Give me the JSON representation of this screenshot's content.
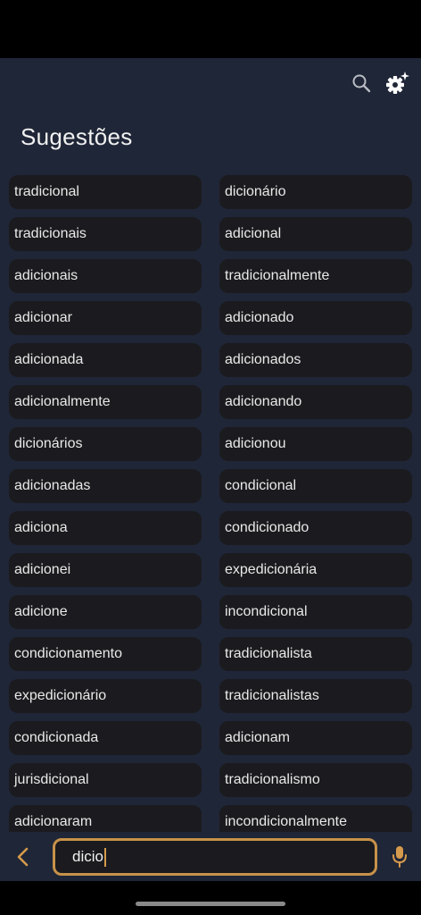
{
  "header": {
    "title": "Sugestões",
    "search_icon": "search-icon",
    "settings_icon": "gear-sparkle-icon"
  },
  "suggestions": [
    "tradicional",
    "dicionário",
    "tradicionais",
    "adicional",
    "adicionais",
    "tradicionalmente",
    "adicionar",
    "adicionado",
    "adicionada",
    "adicionados",
    "adicionalmente",
    "adicionando",
    "dicionários",
    "adicionou",
    "adicionadas",
    "condicional",
    "adiciona",
    "condicionado",
    "adicionei",
    "expedicionária",
    "adicione",
    "incondicional",
    "condicionamento",
    "tradicionalista",
    "expedicionário",
    "tradicionalistas",
    "condicionada",
    "adicionam",
    "jurisdicional",
    "tradicionalismo",
    "adicionaram",
    "incondicionalmente"
  ],
  "search": {
    "value": "dicio"
  },
  "colors": {
    "background": "#1f2637",
    "chip": "#1b1b1f",
    "accent": "#c8924a"
  }
}
